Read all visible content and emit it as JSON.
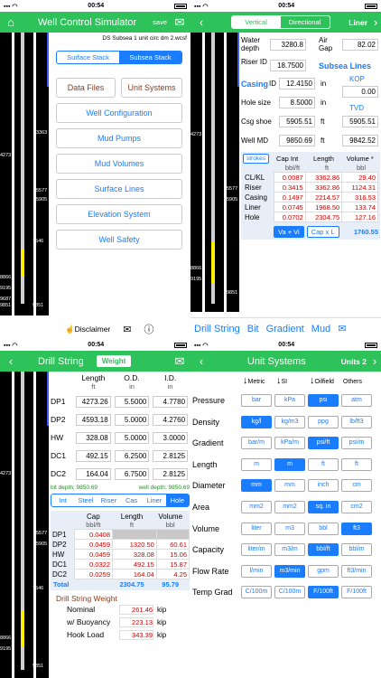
{
  "status": {
    "time": "00:54"
  },
  "q1": {
    "title": "Well Control Simulator",
    "save": "save",
    "filename": "DS Subsea 1 unit circ dm 2.wcsf",
    "stack_tabs": [
      "Surface Stack",
      "Subsea Stack"
    ],
    "data_files": "Data Files",
    "unit_systems": "Unit Systems",
    "menu": [
      "Well Configuration",
      "Mud Pumps",
      "Mud Volumes",
      "Surface Lines",
      "Elevation System",
      "Well Safety"
    ],
    "disclaimer": "Disclaimer",
    "well_labels": [
      "3363",
      "4273",
      "5577",
      "5905",
      "7546",
      "8866",
      "9195",
      "9687",
      "9851",
      "9851"
    ]
  },
  "q2": {
    "tabs": [
      "Vertical",
      "Directional"
    ],
    "liner": "Liner",
    "water_depth_label": "Water depth",
    "water_depth": "3280.8",
    "air_gap_label": "Air Gap",
    "air_gap": "82.02",
    "riser_id_label": "Riser ID",
    "riser_id": "18.7500",
    "subsea_lines": "Subsea Lines",
    "casing_label": "Casing",
    "casing_id_label": "ID",
    "casing_id": "12.4150",
    "unit_in": "in",
    "kop_label": "KOP",
    "kop": "0.00",
    "hole_size_label": "Hole size",
    "hole_size": "8.5000",
    "tvd_label": "TVD",
    "csg_shoe_label": "Csg shoe",
    "csg_shoe": "5905.51",
    "unit_ft": "ft",
    "csg_shoe_tvd": "5905.51",
    "well_md_label": "Well MD",
    "well_md": "9850.69",
    "well_md_tvd": "9842.52",
    "strokes": "strokes",
    "table_headers": [
      "Cap Int",
      "Length",
      "Volume *"
    ],
    "table_units": [
      "bbl/ft",
      "ft",
      "bbl"
    ],
    "rows": [
      {
        "name": "CL/KL",
        "cap": "0.0087",
        "len": "3362.86",
        "vol": "29.40"
      },
      {
        "name": "Riser",
        "cap": "0.3415",
        "len": "3362.86",
        "vol": "1124.31"
      },
      {
        "name": "Casing",
        "cap": "0.1497",
        "len": "2214.57",
        "vol": "316.53"
      },
      {
        "name": "Liner",
        "cap": "0.0745",
        "len": "1968.50",
        "vol": "133.74"
      },
      {
        "name": "Hole",
        "cap": "0.0702",
        "len": "2304.75",
        "vol": "127.16"
      }
    ],
    "btn_vavi": "Va + Vi",
    "btn_capxl": "Cap x L",
    "total": "1760.55",
    "bottom_tabs": [
      "Drill String",
      "Bit",
      "Gradient",
      "Mud"
    ]
  },
  "q3": {
    "title": "Drill String",
    "weight": "Weight",
    "headers": [
      "Length",
      "O.D.",
      "I.D."
    ],
    "units": [
      "ft",
      "in",
      "in"
    ],
    "rows": [
      {
        "name": "DP1",
        "len": "4273.26",
        "od": "5.5000",
        "id": "4.7780"
      },
      {
        "name": "DP2",
        "len": "4593.18",
        "od": "5.0000",
        "id": "4.2760"
      },
      {
        "name": "HW",
        "len": "328.08",
        "od": "5.0000",
        "id": "3.0000"
      },
      {
        "name": "DC1",
        "len": "492.15",
        "od": "6.2500",
        "id": "2.8125"
      },
      {
        "name": "DC2",
        "len": "164.04",
        "od": "6.7500",
        "id": "2.8125"
      }
    ],
    "bit_depth": "bit depth: 9850.69",
    "well_depth": "well depth: 9850.69",
    "segs": [
      "Int",
      "Steel",
      "Riser",
      "Cas",
      "Liner",
      "Hole"
    ],
    "cap_headers": [
      "Cap",
      "Length",
      "Volume"
    ],
    "cap_units": [
      "bbl/ft",
      "ft",
      "bbl"
    ],
    "cap_rows": [
      {
        "name": "DP1",
        "cap": "0.0408",
        "len": "",
        "vol": ""
      },
      {
        "name": "DP2",
        "cap": "0.0459",
        "len": "1320.50",
        "vol": "60.61"
      },
      {
        "name": "HW",
        "cap": "0.0459",
        "len": "328.08",
        "vol": "15.06"
      },
      {
        "name": "DC1",
        "cap": "0.0322",
        "len": "492.15",
        "vol": "15.87"
      },
      {
        "name": "DC2",
        "cap": "0.0259",
        "len": "164.04",
        "vol": "4.25"
      }
    ],
    "total_label": "Total",
    "total_len": "2304.75",
    "total_vol": "95.79",
    "dsw_title": "Drill String Weight",
    "nominal_label": "Nominal",
    "nominal": "261.46",
    "buoy_label": "w/ Buoyancy",
    "buoy": "223.13",
    "hook_label": "Hook Load",
    "hook": "343.39",
    "kip": "kip",
    "well_labels": [
      "4273",
      "5577",
      "5905",
      "7546",
      "8866",
      "9195",
      "9851"
    ]
  },
  "q4": {
    "title": "Unit Systems",
    "units2": "Units 2",
    "cols": [
      "Metric",
      "SI",
      "Oilfield",
      "Others"
    ],
    "rows": [
      {
        "label": "Pressure",
        "opts": [
          "bar",
          "kPa",
          "psi",
          "atm"
        ],
        "sel": 2
      },
      {
        "label": "Density",
        "opts": [
          "kg/l",
          "kg/m3",
          "ppg",
          "lb/ft3"
        ],
        "sel": 0
      },
      {
        "label": "Gradient",
        "opts": [
          "bar/m",
          "kPa/m",
          "psi/ft",
          "psi/m"
        ],
        "sel": 2
      },
      {
        "label": "Length",
        "opts": [
          "m",
          "m",
          "ft",
          "ft"
        ],
        "sel": 1
      },
      {
        "label": "Diameter",
        "opts": [
          "mm",
          "mm",
          "inch",
          "cm"
        ],
        "sel": 0
      },
      {
        "label": "Area",
        "opts": [
          "mm2",
          "mm2",
          "sq. in",
          "cm2"
        ],
        "sel": 2
      },
      {
        "label": "Volume",
        "opts": [
          "liter",
          "m3",
          "bbl",
          "ft3"
        ],
        "sel": 3
      },
      {
        "label": "Capacity",
        "opts": [
          "liter/m",
          "m3/m",
          "bbl/ft",
          "bbl/m"
        ],
        "sel": 2
      },
      {
        "label": "Flow Rate",
        "opts": [
          "l/min",
          "m3/min",
          "gpm",
          "ft3/min"
        ],
        "sel": 1
      },
      {
        "label": "Temp Grad",
        "opts": [
          "C/100m",
          "C/100m",
          "F/100ft",
          "F/100ft"
        ],
        "sel": 2
      }
    ]
  }
}
